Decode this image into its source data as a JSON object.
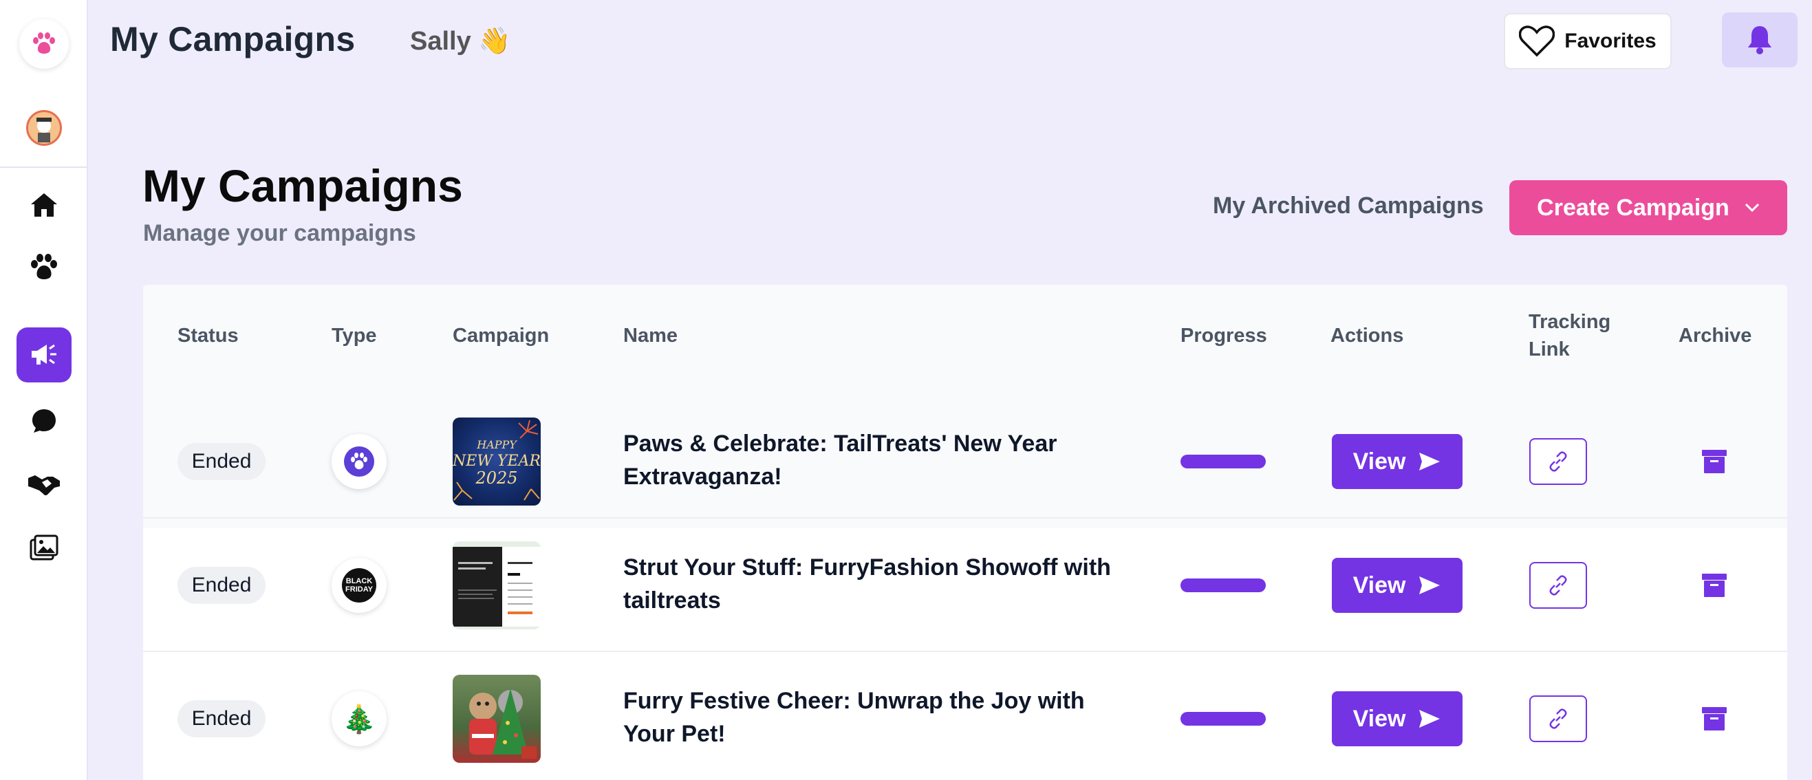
{
  "header": {
    "title": "My Campaigns",
    "greeting": "Sally 👋",
    "favorites_label": "Favorites"
  },
  "page": {
    "title": "My Campaigns",
    "subtitle": "Manage your campaigns",
    "archived_link": "My Archived Campaigns",
    "create_button": "Create Campaign"
  },
  "table": {
    "columns": {
      "status": "Status",
      "type": "Type",
      "campaign": "Campaign",
      "name": "Name",
      "progress": "Progress",
      "actions": "Actions",
      "tracking_line1": "Tracking",
      "tracking_line2": "Link",
      "archive": "Archive"
    },
    "rows": [
      {
        "status": "Ended",
        "type_icon": "paw-icon",
        "thumb_line1": "HAPPY",
        "thumb_line2": "NEW YEAR",
        "thumb_line3": "2025",
        "name": "Paws & Celebrate: TailTreats' New Year Extravaganza!",
        "progress": 1.0,
        "view_label": "View"
      },
      {
        "status": "Ended",
        "type_icon": "black-friday-icon",
        "type_line1": "BLACK",
        "type_line2": "FRIDAY",
        "name": "Strut Your Stuff: FurryFashion Showoff with tailtreats",
        "progress": 1.0,
        "view_label": "View"
      },
      {
        "status": "Ended",
        "type_icon": "christmas-tree-icon",
        "type_glyph": "🎄",
        "name": "Furry Festive Cheer: Unwrap the Joy with Your Pet!",
        "progress": 1.0,
        "view_label": "View"
      }
    ]
  },
  "colors": {
    "accent": "#7434e4",
    "pink": "#ec4d9b",
    "background": "#efedfb"
  }
}
